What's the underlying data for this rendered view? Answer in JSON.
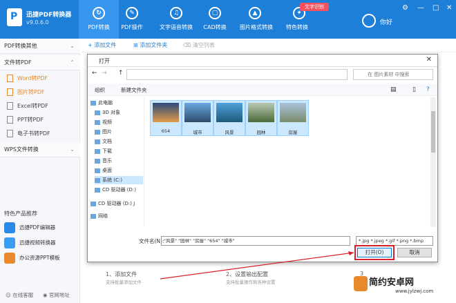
{
  "app": {
    "name": "迅捷PDF转换器",
    "version": "v9.0.6.0"
  },
  "nav": [
    {
      "label": "PDF转换",
      "icon": "pdf-convert-icon"
    },
    {
      "label": "PDF操作",
      "icon": "pdf-ops-icon"
    },
    {
      "label": "文字语音转换",
      "icon": "voice-icon"
    },
    {
      "label": "CAD转换",
      "icon": "cad-icon"
    },
    {
      "label": "图片格式转换",
      "icon": "image-format-icon"
    },
    {
      "label": "特色转换",
      "icon": "special-icon"
    }
  ],
  "badge": "文字识别",
  "user": {
    "name": "你好"
  },
  "sidebar": {
    "sec1": "PDF转换其他",
    "sec2": "文件转PDF",
    "items": [
      "Word转PDF",
      "图片转PDF",
      "Excel转PDF",
      "PPT转PDF",
      "电子书转PDF"
    ],
    "sec3": "WPS文件转换",
    "feat_title": "特色产品推荐",
    "products": [
      "迅捷PDF编辑器",
      "迅捷视频转换器",
      "办公资源PPT模板"
    ],
    "footer": [
      "在线客服",
      "官网地址"
    ]
  },
  "toolbar": {
    "add_file": "添加文件",
    "add_folder": "添加文件夹",
    "clear": "清空列表"
  },
  "steps": [
    {
      "title": "1、添加文件",
      "hint": "支持批量添加文件"
    },
    {
      "title": "2、设置输出配置",
      "hint": "支持批量操作和各种设置"
    },
    {
      "title": "3",
      "hint": ""
    }
  ],
  "dialog": {
    "title": "打开",
    "search_placeholder": "在 图片素材 中搜索",
    "organize": "组织",
    "new_folder": "新建文件夹",
    "tree": [
      "此电脑",
      "3D 对象",
      "视频",
      "图片",
      "文档",
      "下载",
      "音乐",
      "桌面",
      "系统 (C:)",
      "CD 驱动器 (D:)",
      "CD 驱动器 (D:) J",
      "网络"
    ],
    "files": [
      "654",
      "城市",
      "风景",
      "园林",
      "房屋"
    ],
    "filename_label": "文件名(N):",
    "filename_value": "\"风景\" \"园林\" \"房屋\" \"654\" \"城市\"",
    "filetype": "*.jpg *.jpeg *.gif *.png *.bmp",
    "open": "打开(O)",
    "cancel": "取消"
  },
  "watermark": {
    "name": "简约安卓网",
    "url": "www.jylzwj.com"
  }
}
